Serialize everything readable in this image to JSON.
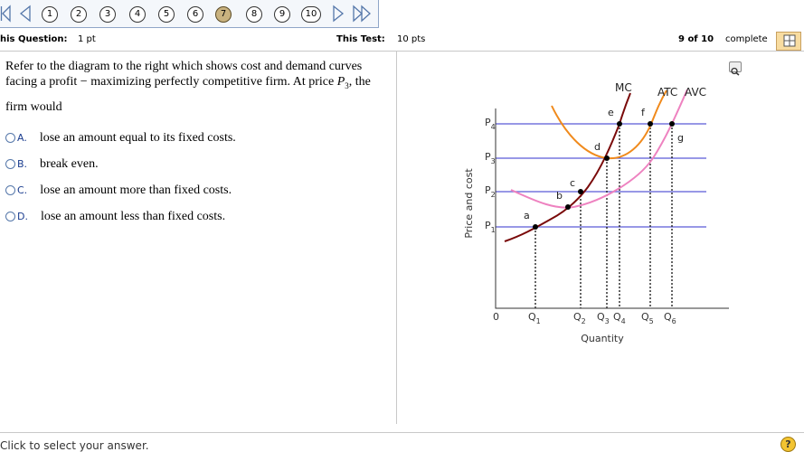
{
  "nav": {
    "questions": [
      "1",
      "2",
      "3",
      "4",
      "5",
      "6",
      "7",
      "8",
      "9",
      "10"
    ],
    "current": "7"
  },
  "info": {
    "this_question_label": "his Question:",
    "this_question_value": "1 pt",
    "this_test_label": "This Test:",
    "this_test_value": "10 pts",
    "progress": "9 of 10",
    "complete_label": "complete"
  },
  "question": {
    "line1": "Refer to the diagram to the right which shows cost and demand curves",
    "line2_pre": "facing a profit − maximizing perfectly competitive firm. At price ",
    "price_symbol": "P",
    "price_sub": "3",
    "line2_post": ", the",
    "line3": "firm would"
  },
  "choices": [
    {
      "letter": "A.",
      "text": "lose an amount equal to its fixed costs."
    },
    {
      "letter": "B.",
      "text": "break even."
    },
    {
      "letter": "C.",
      "text": "lose an amount more than fixed costs."
    },
    {
      "letter": "D.",
      "text": "lose an amount less than fixed costs."
    }
  ],
  "footer": {
    "hint": "Click to select your answer.",
    "help": "?"
  },
  "diagram": {
    "ylabel": "Price and cost",
    "xlabel": "Quantity",
    "origin": "0",
    "curve_labels": {
      "mc": "MC",
      "atc": "ATC",
      "avc": "AVC"
    },
    "price_labels": [
      {
        "main": "P",
        "sub": "4"
      },
      {
        "main": "P",
        "sub": "3"
      },
      {
        "main": "P",
        "sub": "2"
      },
      {
        "main": "P",
        "sub": "1"
      }
    ],
    "q_labels": [
      {
        "main": "Q",
        "sub": "1"
      },
      {
        "main": "Q",
        "sub": "2"
      },
      {
        "main": "Q",
        "sub": "3"
      },
      {
        "main": "Q",
        "sub": "4"
      },
      {
        "main": "Q",
        "sub": "5"
      },
      {
        "main": "Q",
        "sub": "6"
      }
    ],
    "point_labels": [
      "a",
      "b",
      "c",
      "d",
      "e",
      "f",
      "g"
    ],
    "colors": {
      "mc": "#7a0a0a",
      "atc": "#f08a1c",
      "avc": "#ee82c0",
      "price": "#7777dd"
    }
  }
}
